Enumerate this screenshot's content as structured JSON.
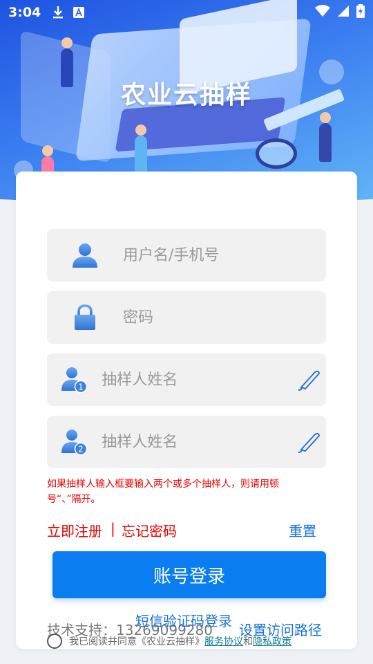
{
  "status_bar": {
    "time": "3:04",
    "icons": [
      "download-icon",
      "font-app-icon"
    ],
    "right_icons": [
      "wifi-icon",
      "signal-icon",
      "battery-charging-icon"
    ]
  },
  "hero": {
    "app_title": "农业云抽样"
  },
  "form": {
    "username_placeholder": "用户名/手机号",
    "password_placeholder": "密码",
    "sampler1_placeholder": "抽样人姓名",
    "sampler2_placeholder": "抽样人姓名",
    "notice": "如果抽样人输入框要输入两个或多个抽样人，则请用顿号“、”隔开。"
  },
  "links": {
    "register": "立即注册",
    "separator": "|",
    "forgot": "忘记密码",
    "reset": "重置"
  },
  "login_button": "账号登录",
  "footer": {
    "support": "技术支持：13269099280",
    "sms_login": "短信验证码登录",
    "set_path": "设置访问路径",
    "agree_prefix": "我已阅读并同意《农业云抽样》",
    "service_agreement": "服务协议",
    "and": "和",
    "privacy_policy": "隐私政策"
  },
  "colors": {
    "primary": "#0a7df0",
    "link_blue": "#1a73d6",
    "warning_red": "#e60000",
    "field_bg": "#f1f1f1",
    "icon_blue": "#3b82d8"
  }
}
